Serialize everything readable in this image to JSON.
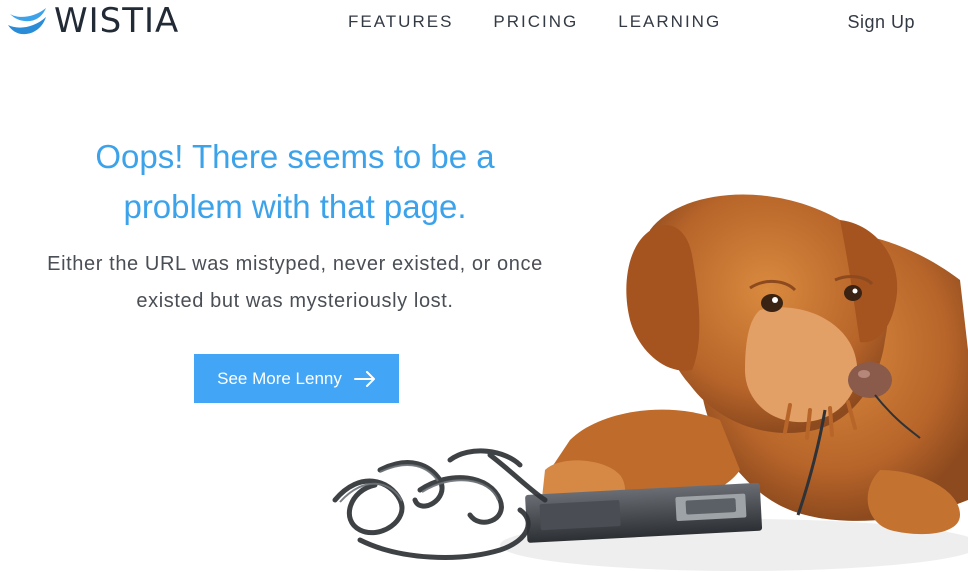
{
  "brand": {
    "name": "WISTIA",
    "logo_icon": "wistia-wave-icon",
    "color": "#3ca2ea"
  },
  "nav": {
    "items": [
      {
        "label": "FEATURES"
      },
      {
        "label": "PRICING"
      },
      {
        "label": "LEARNING"
      }
    ],
    "signup_label": "Sign Up"
  },
  "hero": {
    "title": "Oops! There seems to be a problem with that page.",
    "subtitle": "Either the URL was mistyped, never existed, or once existed but was mysteriously lost.",
    "cta_label": "See More Lenny",
    "cta_icon": "arrow-right-icon",
    "title_color": "#3ca2ea",
    "cta_color": "#42a5f5"
  },
  "illustration": {
    "subject": "dog-with-tangled-videotape"
  }
}
